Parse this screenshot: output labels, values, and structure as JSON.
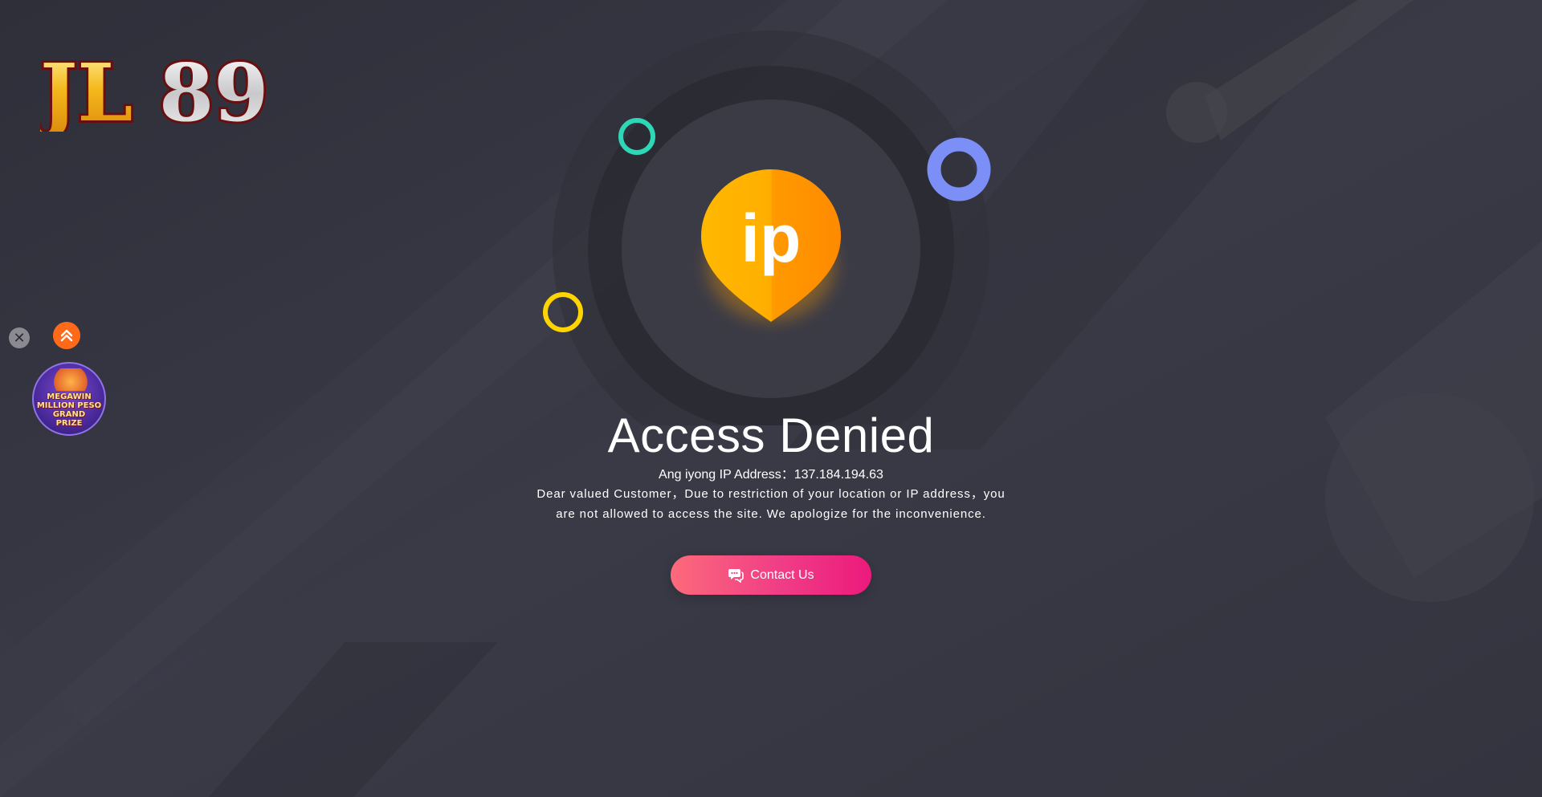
{
  "brand": {
    "logo_text": "JL89"
  },
  "main": {
    "title": "Access Denied",
    "ip_line": "Ang iyong IP Address：137.184.194.63",
    "message": "Dear valued Customer，Due to restriction of your location or IP address，you are not allowed to access the site. We apologize for the inconvenience.",
    "badge_text": "ip"
  },
  "contact_button": {
    "label": "Contact Us",
    "icon": "chat-bubble-icon"
  },
  "floating": {
    "close_icon": "close-icon",
    "scroll_top_icon": "double-chevron-up-icon",
    "promo_lines": [
      "MEGAWIN",
      "MILLION PESO",
      "GRAND",
      "PRIZE"
    ]
  },
  "colors": {
    "background": "#34343f",
    "badge": "#ffa500",
    "button_start": "#fc6a7b",
    "button_end": "#ec1a7c",
    "ring_teal": "#2ed8b6",
    "ring_blue": "#7b8ff7",
    "ring_yellow": "#ffd400",
    "scroll_top": "#ff6a1a"
  }
}
